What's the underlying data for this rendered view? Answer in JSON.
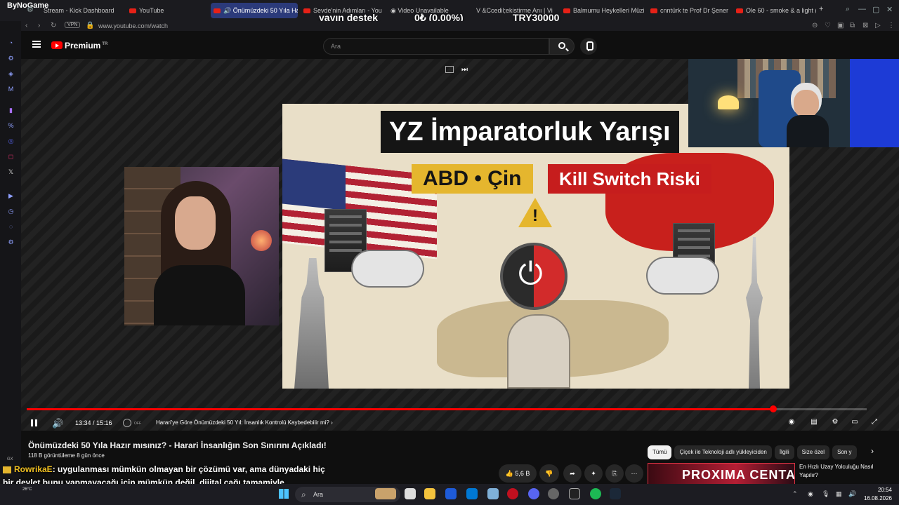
{
  "browser": {
    "overlay_logo": "ByNoGame",
    "tabs": [
      {
        "label": "Stream - Kick Dashboard"
      },
      {
        "label": "YouTube"
      },
      {
        "label": "Önümüzdeki 50 Yıla Ha"
      },
      {
        "label": "Sevde'nin Adımları - You"
      },
      {
        "label": "Video Unavailable"
      },
      {
        "label": "&Ccedil;ekistirme Anı | Vi"
      },
      {
        "label": "Balmumu Heykelleri Müzi"
      },
      {
        "label": "cnntürk te Prof Dr Şener"
      },
      {
        "label": "Ole 60 - smoke & a light ("
      }
    ],
    "url": "www.youtube.com/watch",
    "vpn_label": "VPN"
  },
  "stream_overlay": {
    "label": "yayın destek",
    "progress": "0₺ (0.00%)",
    "goal": "TRY30000"
  },
  "youtube": {
    "brand": "Premium",
    "brand_region": "TR",
    "search_placeholder": "Ara"
  },
  "thumbnail": {
    "title": "YZ İmparatorluk Yarışı",
    "badge_left": "ABD • Çin",
    "badge_right": "Kill Switch Riski"
  },
  "player": {
    "time": "13:34 / 15:16",
    "progress_fraction": 0.8886,
    "autoplay_label": "OFF",
    "chapter": "Harari'ye Göre Önümüzdeki 50 Yıl: İnsanlık Kontrolü Kaybedebilir mi?",
    "chapter_chevron": "›"
  },
  "video": {
    "title": "Önümüzdeki 50 Yıla Hazır mısınız? - Harari İnsanlığın Son Sınırını Açıkladı!",
    "meta": "118 B görüntüleme  8 gün önce",
    "likes": "5,6 B"
  },
  "chips": [
    "Tümü",
    "Çiçek ile Teknoloji adlı yükleyiciden",
    "İlgili",
    "Size özel",
    "Son y"
  ],
  "recommendation": {
    "thumb_text": "PROXIMA CENTAURI",
    "title": "En Hızlı Uzay Yolculuğu Nasıl Yapılır?"
  },
  "chat": {
    "user": "RowrikaE",
    "message": ": uygulanması mümkün olmayan bir çözümü var, ama dünyadaki hiç bir devlet bunu yapmayacağı için mümkün değil. dijital çağı tamamiyle sonlandırmak :)",
    "gx_label": "GX"
  },
  "taskbar": {
    "search_placeholder": "Ara",
    "weather": "26°C",
    "time": "20:54",
    "date": "16.08.2026"
  }
}
